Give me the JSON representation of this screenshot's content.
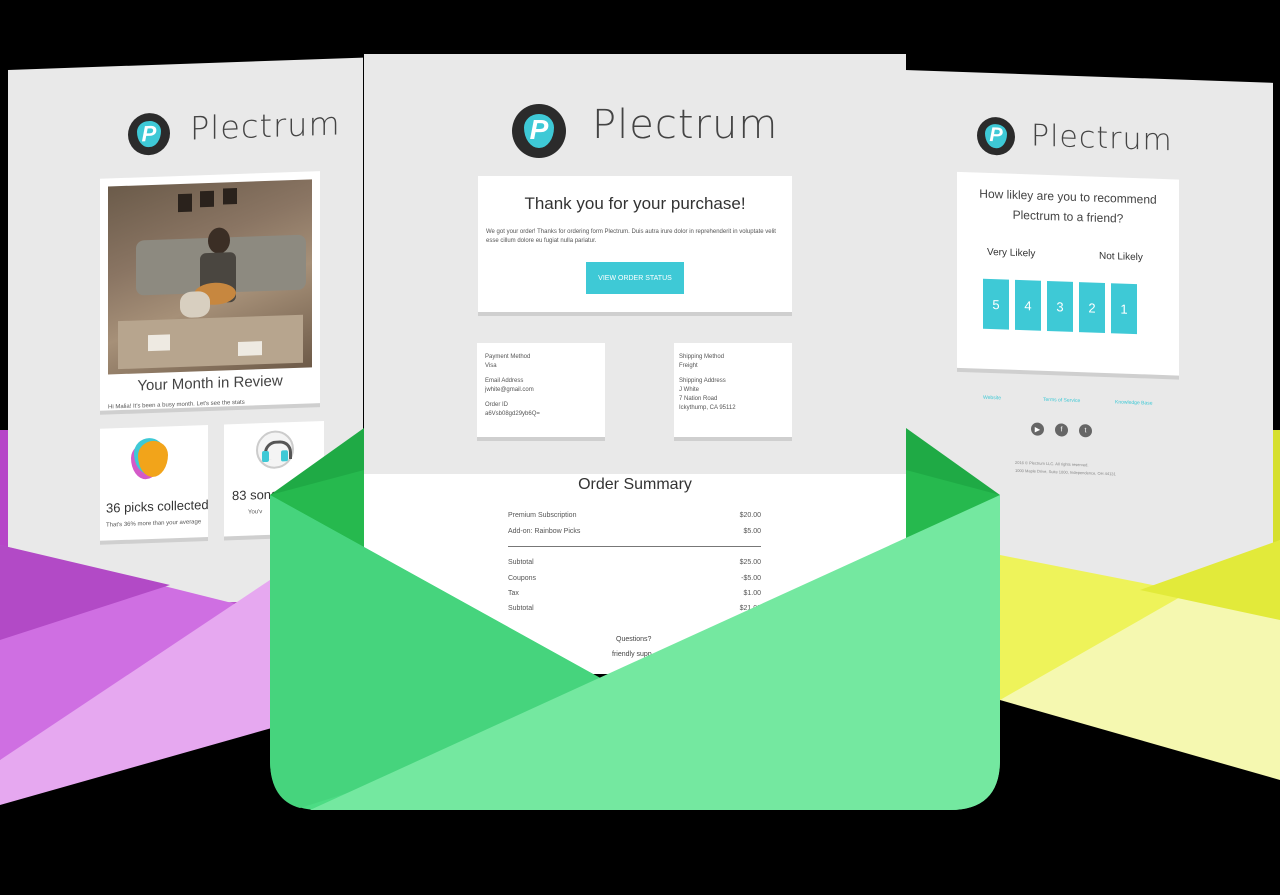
{
  "brand": "Plectrum",
  "left_email": {
    "section_title": "Your Month in Review",
    "greeting": "Hi Malia! It's been a busy month. Let's see the stats",
    "picks_collected": "36 picks collected",
    "picks_note": "That's 36% more than your average",
    "songs": "83 song",
    "songs_note": "You'v"
  },
  "center_email": {
    "headline": "Thank you for your purchase!",
    "body": "We got your order! Thanks for ordering form Plectrum. Duis autra irure dolor in reprehenderit in voluptate velit esse cillum dolore eu fugiat nulla pariatur.",
    "cta": "VIEW ORDER STATUS",
    "payment": {
      "method_label": "Payment Method",
      "method_value": "Visa",
      "email_label": "Email Address",
      "email_value": "jwhite@gmail.com",
      "order_label": "Order ID",
      "order_value": "a6Vsb08gd29yb6Q="
    },
    "shipping": {
      "method_label": "Shipping Method",
      "method_value": "Freight",
      "address_label": "Shipping Address",
      "address_line1": "J White",
      "address_line2": "7 Nation Road",
      "address_line3": "Ickythump, CA 95112"
    },
    "summary_title": "Order Summary",
    "items": [
      {
        "label": "Premium Subscription",
        "value": "$20.00"
      },
      {
        "label": "Add-on: Rainbow Picks",
        "value": "$5.00"
      }
    ],
    "totals": [
      {
        "label": "Subtotal",
        "value": "$25.00"
      },
      {
        "label": "Coupons",
        "value": "-$5.00"
      },
      {
        "label": "Tax",
        "value": "$1.00"
      },
      {
        "label": "Subtotal",
        "value": "$21.00"
      }
    ],
    "questions": "Questions?",
    "questions_note": "friendly supp"
  },
  "right_email": {
    "question_line1": "How likley are you to recommend",
    "question_line2": "Plectrum to a friend?",
    "very_likely": "Very Likely",
    "not_likely": "Not Likely",
    "ratings": [
      "5",
      "4",
      "3",
      "2",
      "1"
    ],
    "footer_links": [
      "Website",
      "Terms of Service",
      "Knowledge Base"
    ],
    "copyright": "2016 © Plectrum LLC. All rights reserved.",
    "address": "1000 Maple Drive, Suite 1000, Independence, OH 44131"
  },
  "colors": {
    "accent": "#3ec9d6",
    "green_envelope": "#4cdc84",
    "purple_envelope": "#d070e0",
    "yellow_envelope": "#eef35a"
  }
}
